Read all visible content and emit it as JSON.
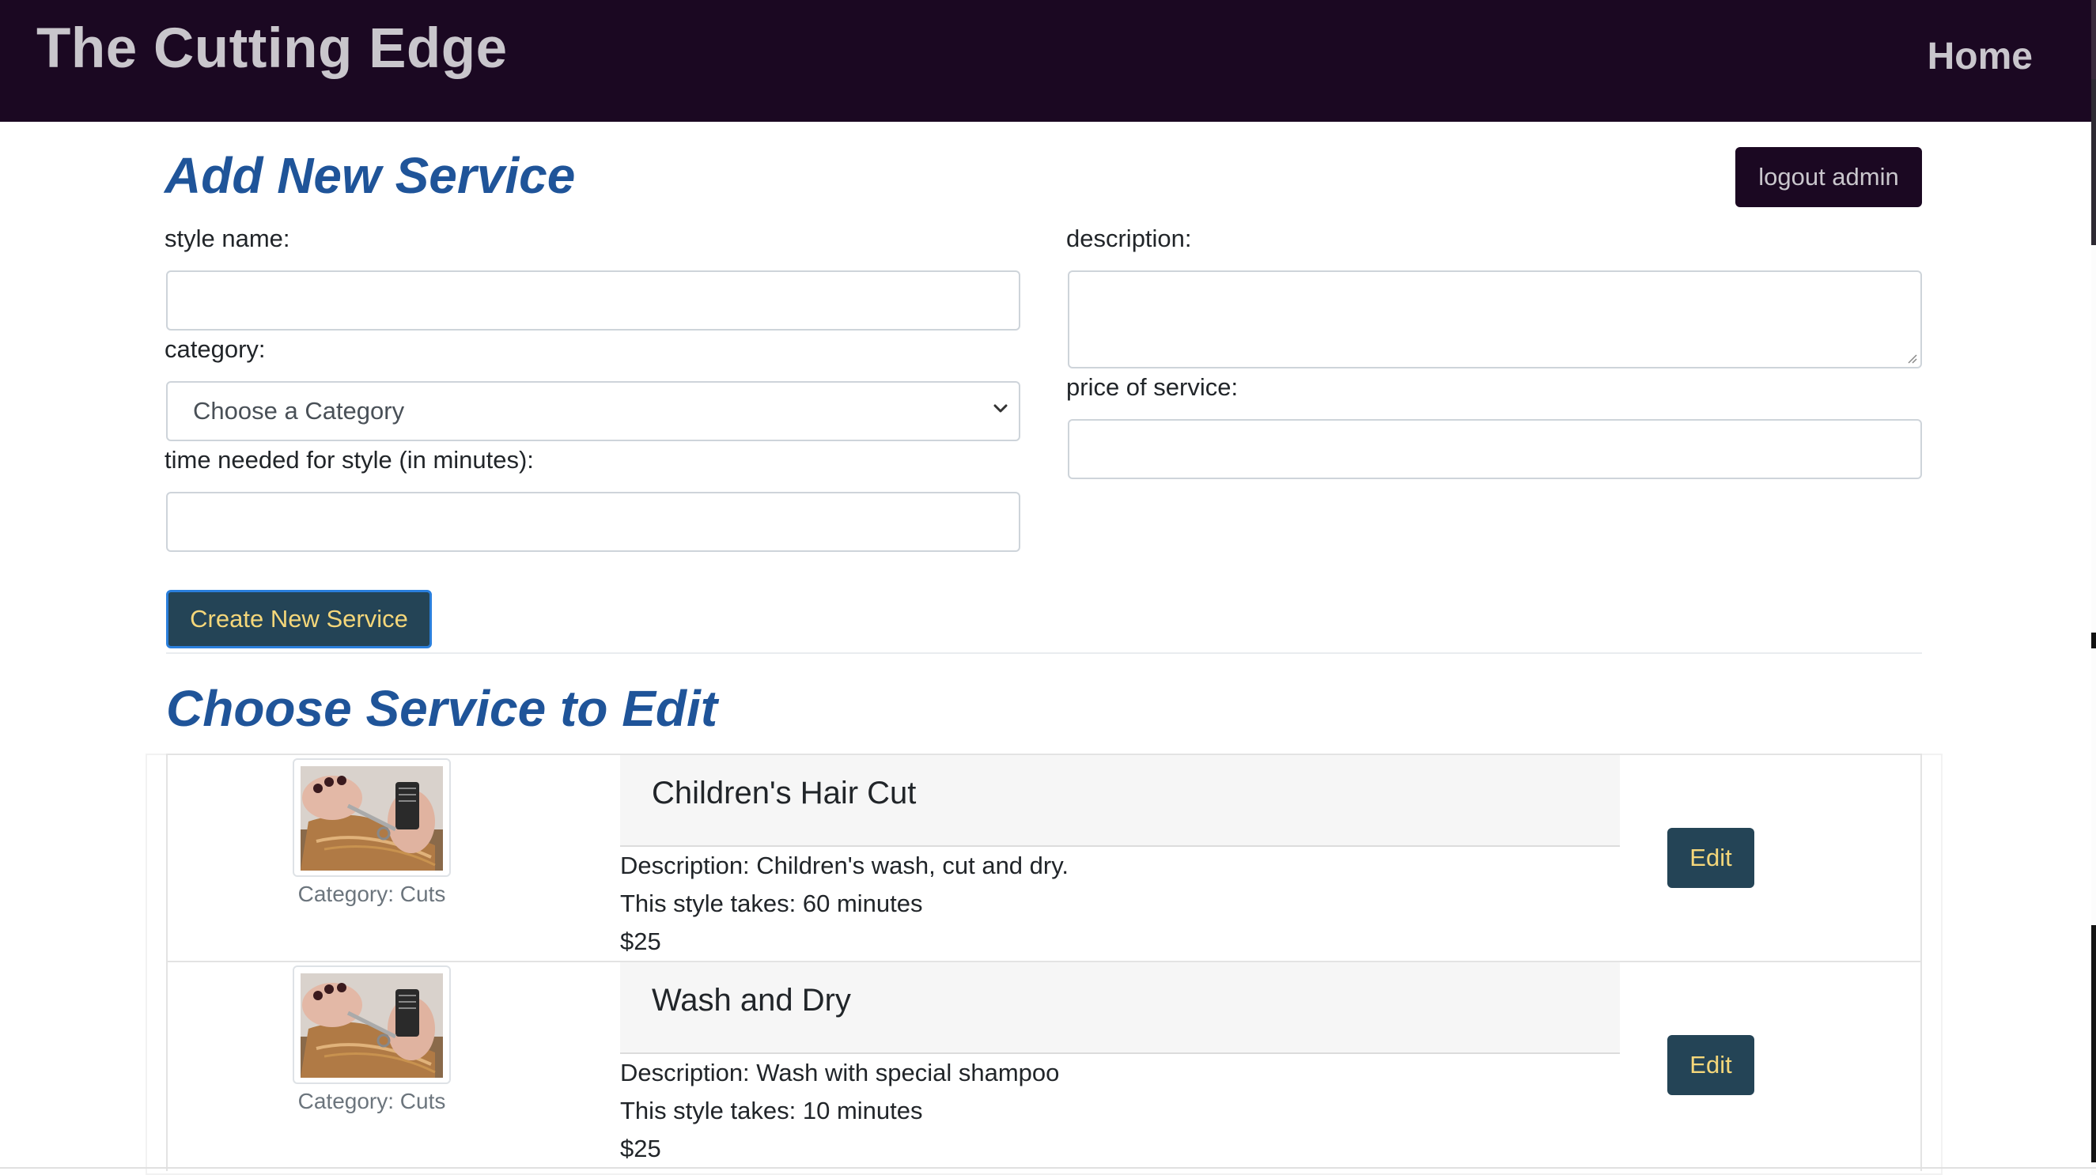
{
  "navbar": {
    "brand": "The Cutting Edge",
    "home_link": "Home"
  },
  "add_service": {
    "heading": "Add New Service",
    "logout_label": "logout admin",
    "style_name_label": "style name:",
    "style_name_value": "",
    "category_label": "category:",
    "category_selected": "Choose a Category",
    "time_label": "time needed for style (in minutes):",
    "time_value": "",
    "description_label": "description:",
    "description_value": "",
    "price_label": "price of service:",
    "price_value": "",
    "create_label": "Create New Service"
  },
  "edit_list": {
    "heading": "Choose Service to Edit",
    "services": [
      {
        "title": "Children's Hair Cut",
        "category": "Category: Cuts",
        "description": "Description: Children's wash, cut and dry.",
        "time": "This style takes: 60 minutes",
        "price": "$25",
        "edit_label": "Edit"
      },
      {
        "title": "Wash and Dry",
        "category": "Category: Cuts",
        "description": "Description: Wash with special shampoo",
        "time": "This style takes: 10 minutes",
        "price": "$25",
        "edit_label": "Edit"
      }
    ]
  },
  "colors": {
    "navbar_bg": "#1b0822",
    "heading": "#1f5499",
    "button_bg": "#244456",
    "button_text": "#f5d77a"
  }
}
